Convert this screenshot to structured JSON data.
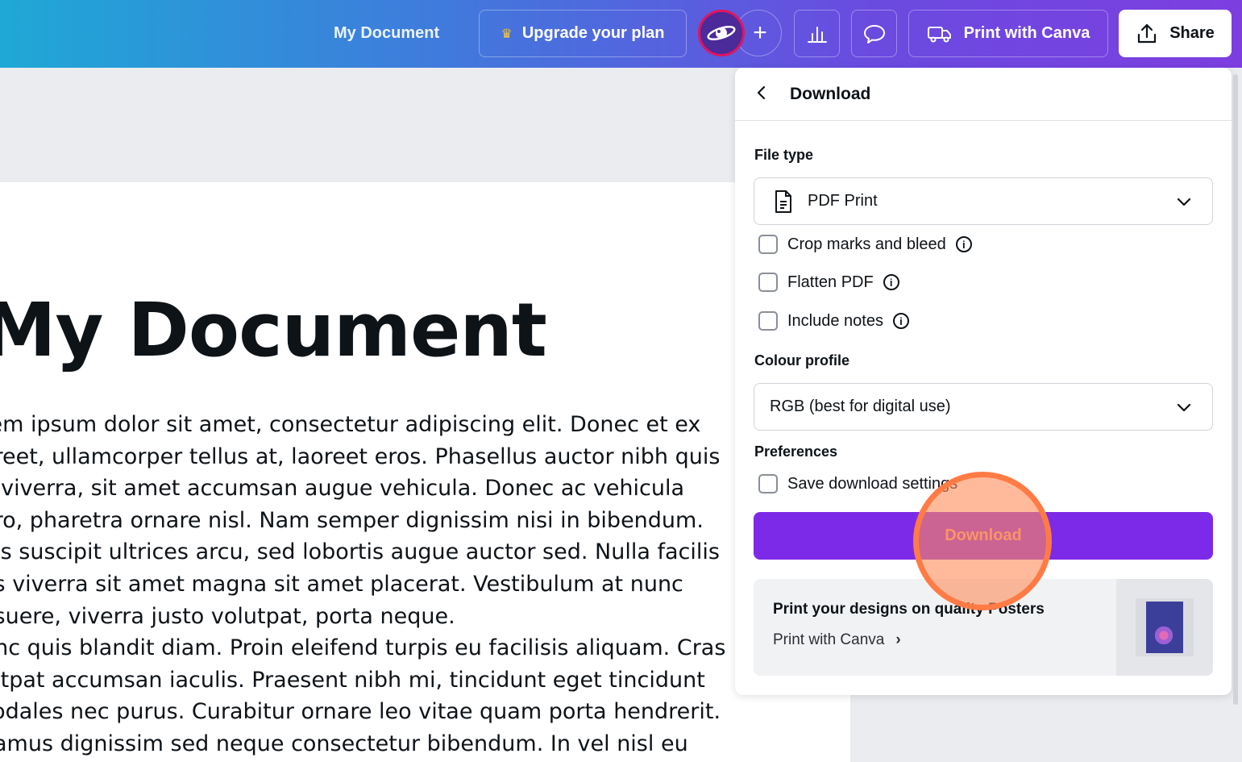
{
  "header": {
    "doc_title": "My Document",
    "upgrade_label": "Upgrade your plan",
    "print_label": "Print with Canva",
    "share_label": "Share",
    "plus_label": "+"
  },
  "document": {
    "heading": "My Document",
    "lines": [
      "rem ipsum dolor sit amet, consectetur adipiscing elit. Donec et ex",
      "oreet, ullamcorper tellus at, laoreet eros. Phasellus auctor nibh quis",
      "o viverra, sit amet accumsan augue vehicula. Donec ac vehicula",
      "ero, pharetra ornare nisl. Nam semper dignissim nisi in bibendum.",
      "uis suscipit ultrices arcu, sed lobortis augue auctor sed. Nulla facilis",
      "as viverra sit amet magna sit amet placerat. Vestibulum at nunc",
      "osuere, viverra justo volutpat, porta neque.",
      "unc quis blandit diam. Proin eleifend turpis eu facilisis aliquam. Cras",
      "lutpat accumsan iaculis. Praesent nibh mi, tincidunt eget tincidunt",
      "sodales nec purus. Curabitur ornare leo vitae quam porta hendrerit.",
      "vamus dignissim sed neque consectetur bibendum. In vel nisl eu"
    ]
  },
  "panel": {
    "title": "Download",
    "file_type_label": "File type",
    "file_type_value": "PDF Print",
    "checks": {
      "crop": "Crop marks and bleed",
      "flatten": "Flatten PDF",
      "notes": "Include notes"
    },
    "colour_profile_label": "Colour profile",
    "colour_profile_value": "RGB (best for digital use)",
    "preferences_label": "Preferences",
    "save_settings_label": "Save download settings",
    "download_button": "Download",
    "promo_title": "Print your designs on quality Posters",
    "promo_link": "Print with Canva"
  },
  "colors": {
    "accent": "#7d2ae8",
    "highlight": "#ff7b45"
  }
}
